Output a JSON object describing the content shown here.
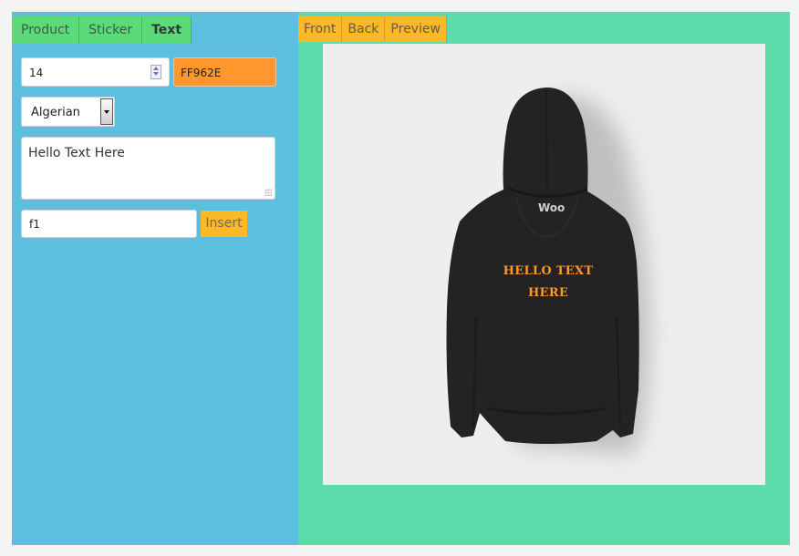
{
  "left_panel": {
    "tabs": [
      {
        "label": "Product",
        "active": false
      },
      {
        "label": "Sticker",
        "active": false
      },
      {
        "label": "Text",
        "active": true
      }
    ],
    "font_size": "14",
    "color_value": "FF962E",
    "color_hex": "#ff962e",
    "font_family": "Algerian",
    "text_value": "Hello Text Here",
    "field_id": "f1",
    "insert_label": "Insert"
  },
  "right_panel": {
    "tabs": [
      {
        "label": "Front"
      },
      {
        "label": "Back"
      },
      {
        "label": "Preview"
      }
    ],
    "canvas": {
      "product": "black hoodie (back view)",
      "brand_label": "Woo",
      "design_text_line1": "HELLO TEXT",
      "design_text_line2": "HERE"
    }
  }
}
